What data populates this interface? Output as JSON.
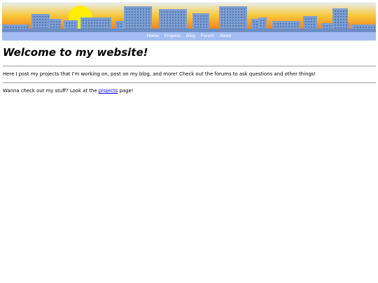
{
  "banner": {
    "sky_top": "#e8f0f6",
    "sky_mid": "#f8c838",
    "sky_bottom": "#f07018",
    "sun": "#ffee00",
    "building": "#7f9fd0",
    "window": "#4f78b8",
    "ground": "#6d8ec4"
  },
  "nav": {
    "items": [
      {
        "label": "Home"
      },
      {
        "label": "Projects"
      },
      {
        "label": "Blog"
      },
      {
        "label": "Forum"
      },
      {
        "label": "About"
      }
    ]
  },
  "main": {
    "heading": "Welcome to my website!",
    "intro": "Here I post my projects that I'm working on, post on my blog, and more! Check out the forums to ask questions and other things!",
    "cta_before": "Wanna check out my stuff? Look at the ",
    "cta_link": "projects",
    "cta_after": " page!"
  }
}
